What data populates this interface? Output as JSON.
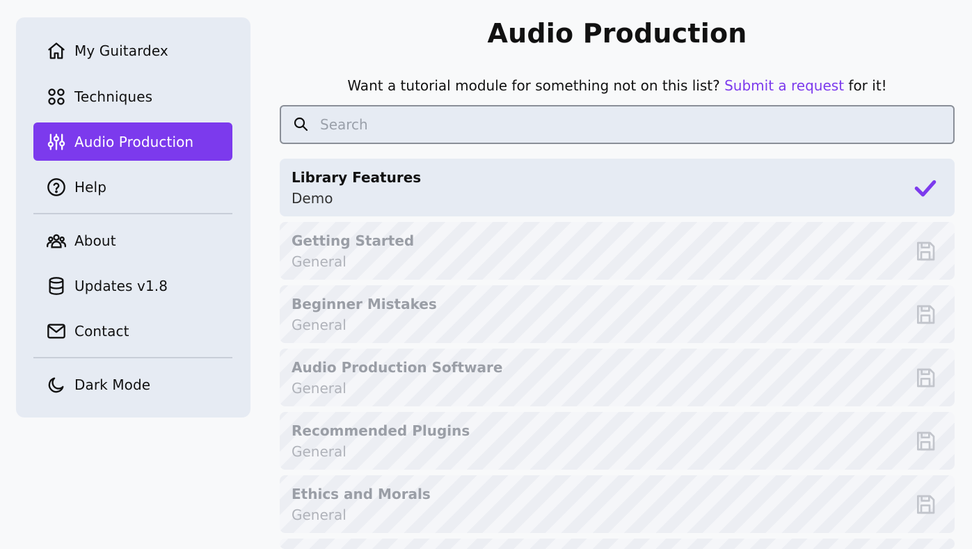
{
  "sidebar": {
    "items": [
      {
        "label": "My Guitardex",
        "icon": "home-icon"
      },
      {
        "label": "Techniques",
        "icon": "grid-icon"
      },
      {
        "label": "Audio Production",
        "icon": "sliders-icon",
        "active": true
      },
      {
        "label": "Help",
        "icon": "help-circle-icon"
      },
      {
        "label": "About",
        "icon": "users-icon"
      },
      {
        "label": "Updates v1.8",
        "icon": "database-icon"
      },
      {
        "label": "Contact",
        "icon": "mail-icon"
      },
      {
        "label": "Dark Mode",
        "icon": "moon-icon"
      }
    ]
  },
  "main": {
    "title": "Audio Production",
    "request": {
      "prefix": "Want a tutorial module for something not on this list?",
      "link": "Submit a request",
      "suffix": "for it!"
    },
    "search": {
      "placeholder": "Search",
      "value": ""
    },
    "modules": [
      {
        "title": "Library Features",
        "category": "Demo",
        "state": "completed",
        "icon": "check-icon"
      },
      {
        "title": "Getting Started",
        "category": "General",
        "state": "locked",
        "icon": "save-icon"
      },
      {
        "title": "Beginner Mistakes",
        "category": "General",
        "state": "locked",
        "icon": "save-icon"
      },
      {
        "title": "Audio Production Software",
        "category": "General",
        "state": "locked",
        "icon": "save-icon"
      },
      {
        "title": "Recommended Plugins",
        "category": "General",
        "state": "locked",
        "icon": "save-icon"
      },
      {
        "title": "Ethics and Morals",
        "category": "General",
        "state": "locked",
        "icon": "save-icon"
      }
    ]
  },
  "colors": {
    "accent": "#7c3aed",
    "sidebar_bg": "#e6ebf3",
    "page_bg": "#f8f9fa"
  }
}
